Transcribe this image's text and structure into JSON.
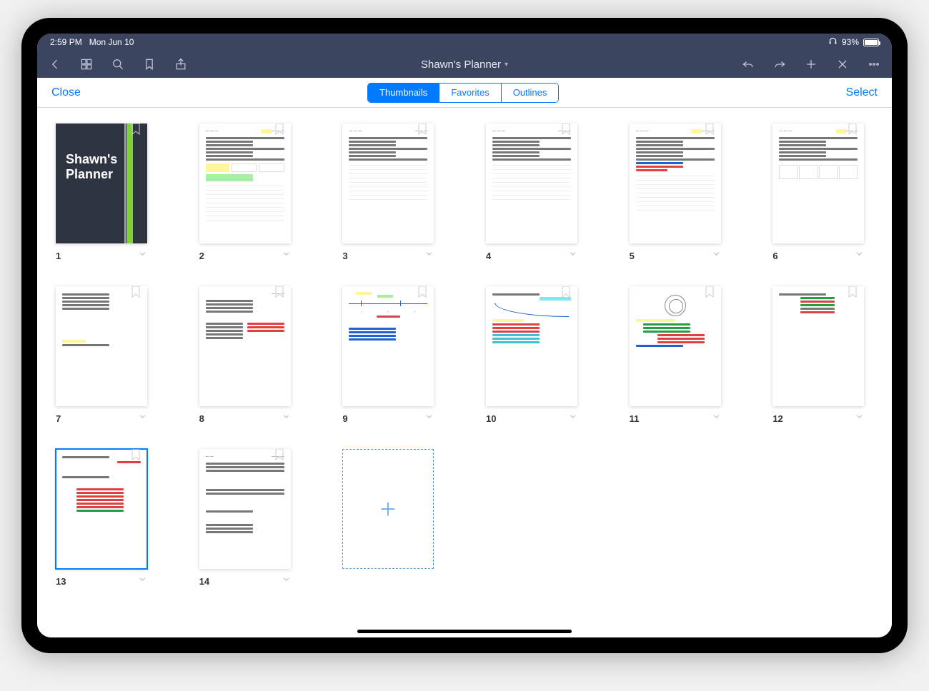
{
  "statusbar": {
    "time": "2:59 PM",
    "date": "Mon Jun 10",
    "battery_pct": "93%"
  },
  "toolbar": {
    "doc_title": "Shawn's Planner"
  },
  "modal": {
    "close_label": "Close",
    "select_label": "Select",
    "tabs": {
      "thumbnails": "Thumbnails",
      "favorites": "Favorites",
      "outlines": "Outlines"
    }
  },
  "cover": {
    "line1": "Shawn's",
    "line2": "Planner"
  },
  "pages": [
    {
      "n": "1",
      "type": "cover",
      "selected": false
    },
    {
      "n": "2",
      "type": "plan",
      "selected": false
    },
    {
      "n": "3",
      "type": "plan",
      "selected": false
    },
    {
      "n": "4",
      "type": "plan",
      "selected": false
    },
    {
      "n": "5",
      "type": "plan",
      "selected": false
    },
    {
      "n": "6",
      "type": "plan",
      "selected": false
    },
    {
      "n": "7",
      "type": "notes",
      "selected": false
    },
    {
      "n": "8",
      "type": "notes",
      "selected": false
    },
    {
      "n": "9",
      "type": "sketch",
      "selected": false
    },
    {
      "n": "10",
      "type": "sketch",
      "selected": false
    },
    {
      "n": "11",
      "type": "sketch",
      "selected": false
    },
    {
      "n": "12",
      "type": "notes",
      "selected": false
    },
    {
      "n": "13",
      "type": "sketch",
      "selected": true
    },
    {
      "n": "14",
      "type": "text",
      "selected": false
    }
  ]
}
